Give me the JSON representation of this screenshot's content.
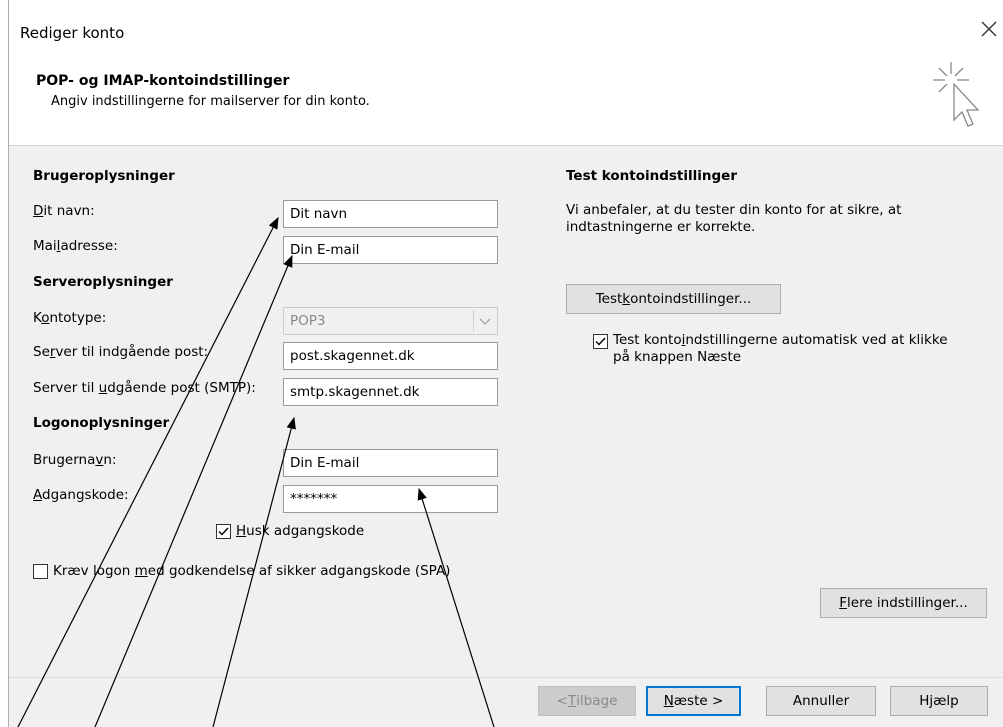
{
  "dialog": {
    "title": "Rediger konto",
    "section_title": "POP- og IMAP-kontoindstillinger",
    "section_subtitle": "Angiv indstillingerne for mailserver for din konto."
  },
  "user_info": {
    "heading": "Brugeroplysninger",
    "name_label": {
      "pre": "",
      "u": "D",
      "post": "it navn:"
    },
    "name_value": "Dit navn",
    "email_label": {
      "pre": "Mai",
      "u": "l",
      "post": "adresse:"
    },
    "email_value": "Din E-mail"
  },
  "server_info": {
    "heading": "Serveroplysninger",
    "account_type_label": {
      "pre": "K",
      "u": "o",
      "post": "ntotype:"
    },
    "account_type_value": "POP3",
    "incoming_label": {
      "pre": "Se",
      "u": "r",
      "post": "ver til indgående post:"
    },
    "incoming_value": "post.skagennet.dk",
    "outgoing_label": {
      "pre": "Server til ",
      "u": "u",
      "post": "dgående post (SMTP):"
    },
    "outgoing_value": "smtp.skagennet.dk"
  },
  "logon_info": {
    "heading": "Logonoplysninger",
    "username_label": {
      "pre": "Brugerna",
      "u": "v",
      "post": "n:"
    },
    "username_value": "Din E-mail",
    "password_label": {
      "pre": "",
      "u": "A",
      "post": "dgangskode:"
    },
    "password_value": "*******",
    "remember_label": {
      "pre": "",
      "u": "H",
      "post": "usk adgangskode"
    },
    "remember_checked": true,
    "spa_label": {
      "pre": "Kræv logon ",
      "u": "m",
      "post": "ed godkendelse af sikker adgangskode (SPA)"
    },
    "spa_checked": false
  },
  "test": {
    "heading": "Test kontoindstillinger",
    "description": "Vi anbefaler, at du tester din konto for at sikre, at indtastningerne er korrekte.",
    "button": {
      "pre": "Test ",
      "u": "k",
      "post": "ontoindstillinger..."
    },
    "auto_label": {
      "pre": "Test konto",
      "u": "i",
      "post": "ndstillingerne automatisk ved at klikke på knappen Næste"
    },
    "auto_checked": true
  },
  "more_settings": {
    "pre": "",
    "u": "F",
    "post": "lere indstillinger..."
  },
  "footer": {
    "back": {
      "pre": "< ",
      "u": "T",
      "post": "ilbage"
    },
    "next": {
      "pre": "",
      "u": "N",
      "post": "æste >"
    },
    "cancel": "Annuller",
    "help": "Hjælp"
  },
  "colors": {
    "accent": "#0078d7",
    "panel": "#f0f0f0"
  }
}
